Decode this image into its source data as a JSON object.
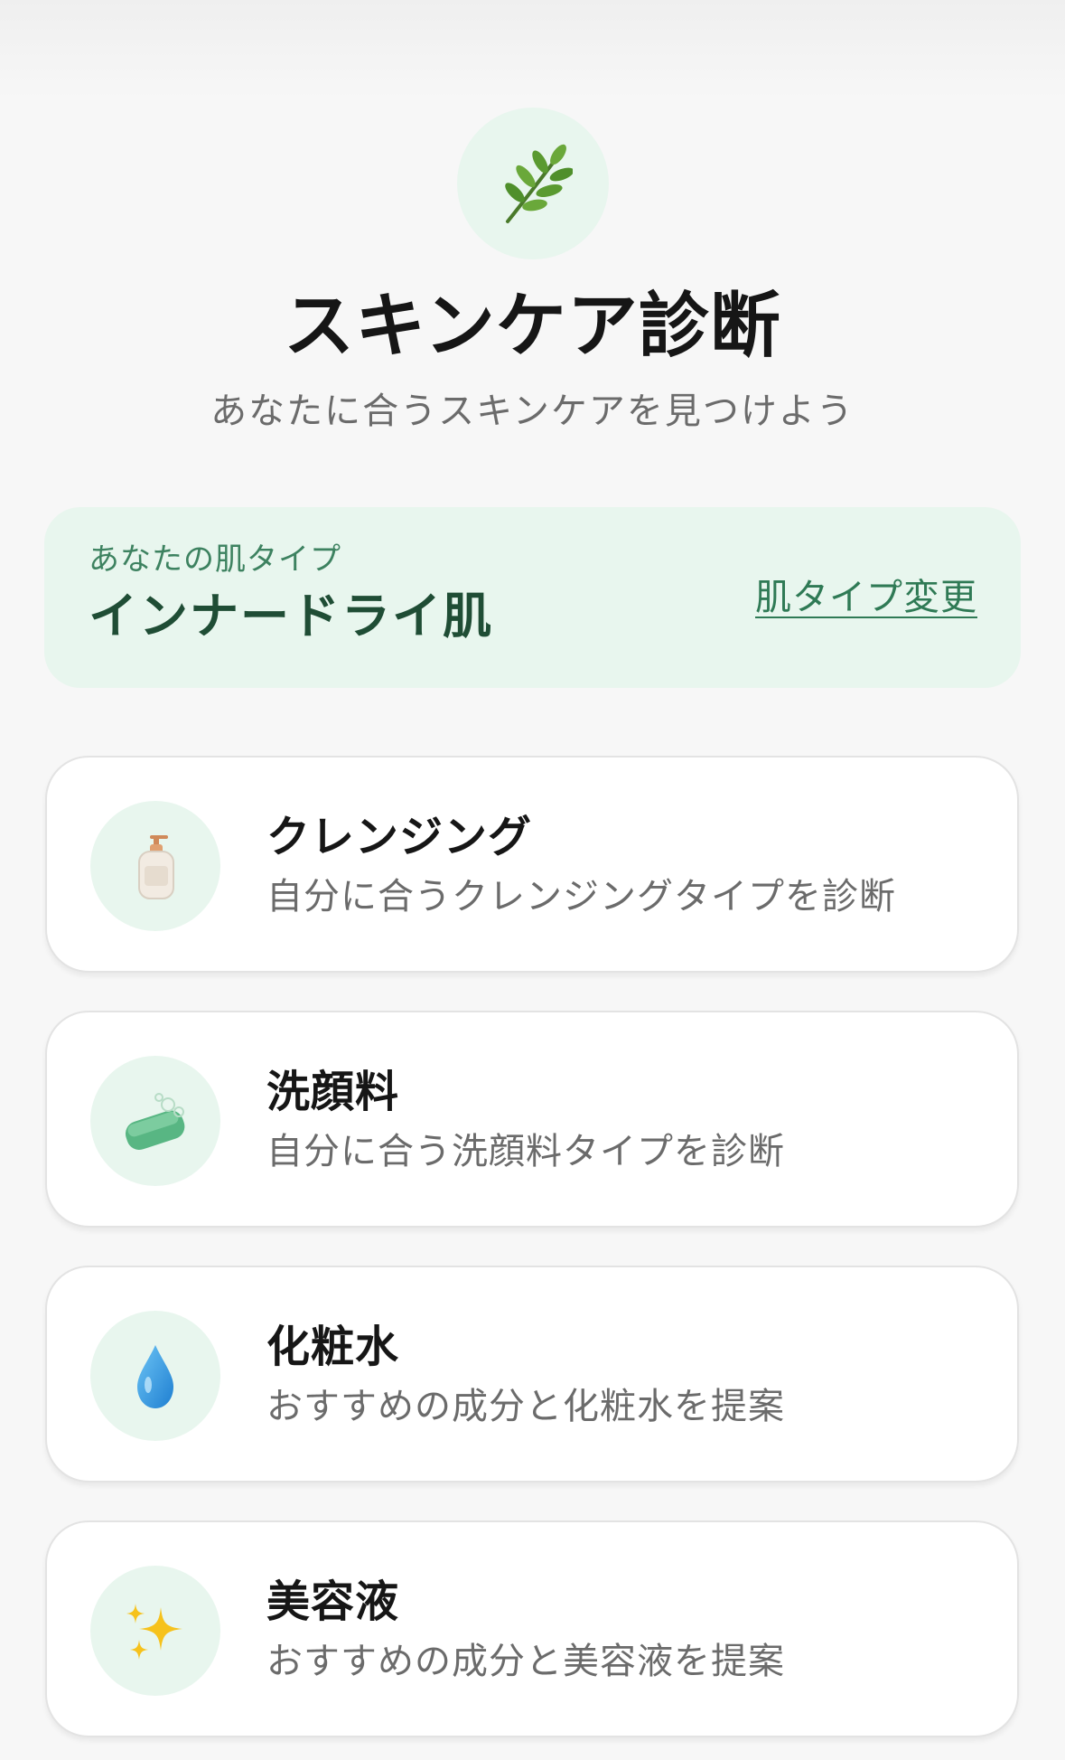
{
  "header": {
    "logo_icon": "leaf-branch-icon",
    "title": "スキンケア診断",
    "subtitle": "あなたに合うスキンケアを見つけよう"
  },
  "skin_type": {
    "label": "あなたの肌タイプ",
    "value": "インナードライ肌",
    "change_link": "肌タイプ変更"
  },
  "menu": [
    {
      "icon": "cleansing-bottle-icon",
      "title": "クレンジング",
      "description": "自分に合うクレンジングタイプを診断"
    },
    {
      "icon": "soap-icon",
      "title": "洗顔料",
      "description": "自分に合う洗顔料タイプを診断"
    },
    {
      "icon": "water-drop-icon",
      "title": "化粧水",
      "description": "おすすめの成分と化粧水を提案"
    },
    {
      "icon": "sparkles-icon",
      "title": "美容液",
      "description": "おすすめの成分と美容液を提案"
    }
  ],
  "colors": {
    "accent_green": "#2f7a55",
    "card_tint": "#e8f6ee",
    "background": "#f7f7f7"
  }
}
